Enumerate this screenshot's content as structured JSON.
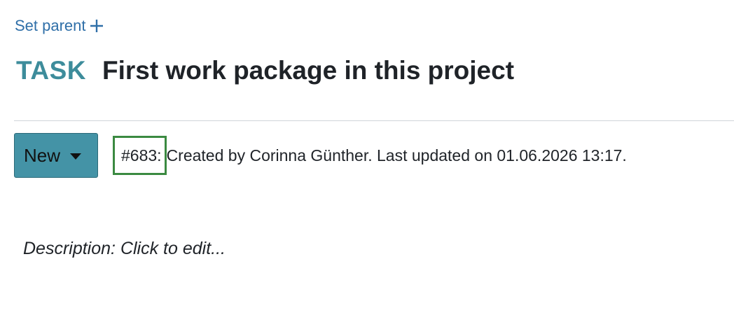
{
  "parent": {
    "set_parent_label": "Set parent",
    "icon": "plus-icon"
  },
  "work_package": {
    "type": "TASK",
    "subject": "First work package in this project",
    "status": "New",
    "id_label": "#683:",
    "meta_text": "Created by Corinna Günther. Last updated on 01.06.2026 13:17.",
    "description_placeholder": "Description: Click to edit..."
  },
  "colors": {
    "link": "#2f6fa8",
    "type": "#3d8c9b",
    "status_button": "#4493a6",
    "id_highlight_border": "#3b8a41"
  }
}
